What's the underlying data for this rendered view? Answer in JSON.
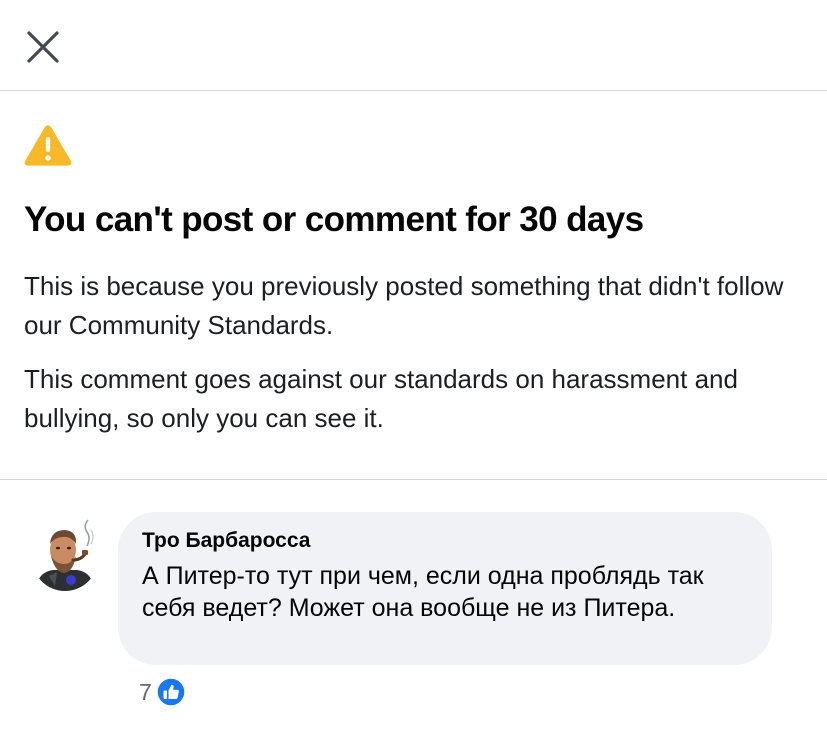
{
  "header": {
    "close_icon": "close-icon"
  },
  "notice": {
    "warning_icon": "warning-triangle-icon",
    "warning_color": "#F7B928",
    "title": "You can't post or comment for 30 days",
    "paragraph1": "This is because you previously posted something that didn't follow our Community Standards.",
    "paragraph2": "This comment goes against our standards on harassment and bullying, so only you can see it."
  },
  "comment": {
    "author": "Тро Барбаросса",
    "text": "А Питер-то тут при чем, если одна проблядь так себя ведет? Может она вообще не из Питера.",
    "reaction_count": "7",
    "reaction_icon": "like-icon",
    "like_color": "#1877F2",
    "bubble_color": "#F0F2F5"
  }
}
